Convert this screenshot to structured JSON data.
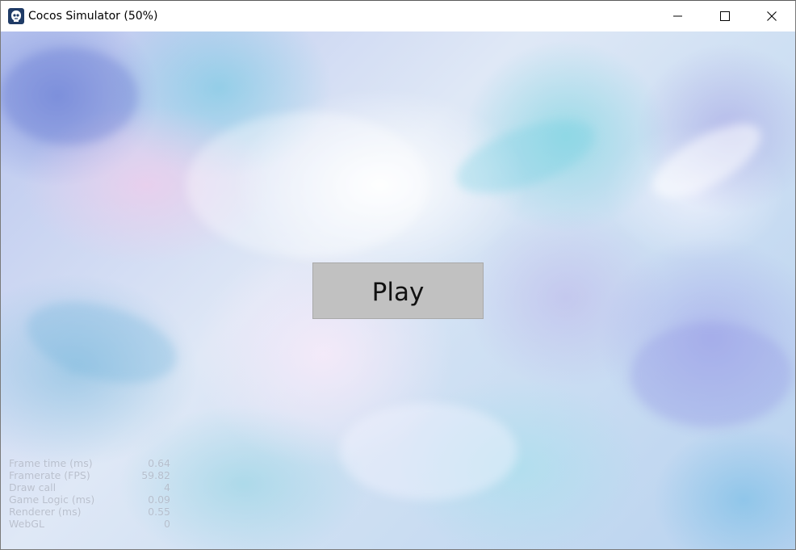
{
  "window": {
    "title": "Cocos Simulator (50%)",
    "app_icon": "cocos-logo-icon",
    "controls": {
      "minimize_icon": "minimize-icon",
      "maximize_icon": "maximize-icon",
      "close_icon": "close-icon"
    }
  },
  "game": {
    "play_button_label": "Play",
    "background": "watercolor smoke texture",
    "button_color": "#c1c1c1"
  },
  "stats": [
    {
      "label": "Frame time (ms)",
      "value": "0.64"
    },
    {
      "label": "Framerate (FPS)",
      "value": "59.82"
    },
    {
      "label": "Draw call",
      "value": "4"
    },
    {
      "label": "Game Logic (ms)",
      "value": "0.09"
    },
    {
      "label": "Renderer (ms)",
      "value": "0.55"
    },
    {
      "label": "WebGL",
      "value": "0"
    }
  ]
}
